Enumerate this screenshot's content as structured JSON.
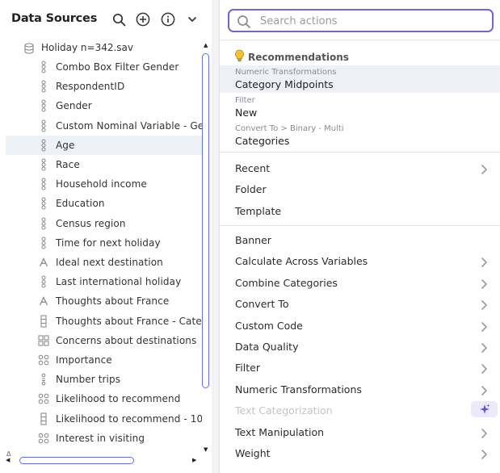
{
  "data_sources": {
    "title": "Data Sources",
    "file": {
      "label": "Holiday n=342.sav"
    },
    "variables": [
      {
        "label": "Combo Box Filter Gender",
        "icon": "numeric-var-icon"
      },
      {
        "label": "RespondentID",
        "icon": "numeric-var-icon"
      },
      {
        "label": "Gender",
        "icon": "numeric-var-icon"
      },
      {
        "label": "Custom Nominal Variable - Gen",
        "icon": "numeric-var-icon"
      },
      {
        "label": "Age",
        "icon": "numeric-var-icon",
        "selected": true
      },
      {
        "label": "Race",
        "icon": "numeric-var-icon"
      },
      {
        "label": "Household income",
        "icon": "numeric-var-icon"
      },
      {
        "label": "Education",
        "icon": "numeric-var-icon"
      },
      {
        "label": "Census region",
        "icon": "numeric-var-icon"
      },
      {
        "label": "Time for next holiday",
        "icon": "numeric-var-icon"
      },
      {
        "label": "Ideal next destination",
        "icon": "text-var-icon"
      },
      {
        "label": "Last international holiday",
        "icon": "numeric-var-icon"
      },
      {
        "label": "Thoughts about France",
        "icon": "text-var-icon"
      },
      {
        "label": "Thoughts about France - Categ",
        "icon": "categorical-var-icon"
      },
      {
        "label": "Concerns about destinations",
        "icon": "grid-var-icon"
      },
      {
        "label": "Importance",
        "icon": "multi-numeric-var-icon"
      },
      {
        "label": "Number trips",
        "icon": "numeric-count-var-icon"
      },
      {
        "label": "Likelihood to recommend",
        "icon": "multi-numeric-var-icon"
      },
      {
        "label": "Likelihood to recommend - 10",
        "icon": "categorical-var-icon"
      },
      {
        "label": "Interest in visiting",
        "icon": "multi-numeric-var-icon"
      }
    ]
  },
  "menu": {
    "search": {
      "placeholder": "Search actions",
      "value": ""
    },
    "recommendations": {
      "heading": "Recommendations",
      "items": [
        {
          "small": "Numeric Transformations",
          "main": "Category Midpoints",
          "highlighted": true
        },
        {
          "small": "Filter",
          "main": "New"
        },
        {
          "small": "Convert To > Binary - Multi",
          "main": "Categories"
        }
      ]
    },
    "group1": [
      {
        "label": "Recent",
        "submenu": true
      },
      {
        "label": "Folder",
        "submenu": false
      },
      {
        "label": "Template",
        "submenu": false
      }
    ],
    "group2": [
      {
        "label": "Banner",
        "submenu": false
      },
      {
        "label": "Calculate Across Variables",
        "submenu": true
      },
      {
        "label": "Combine Categories",
        "submenu": true
      },
      {
        "label": "Convert To",
        "submenu": true
      },
      {
        "label": "Custom Code",
        "submenu": true
      },
      {
        "label": "Data Quality",
        "submenu": true
      },
      {
        "label": "Filter",
        "submenu": true
      },
      {
        "label": "Numeric Transformations",
        "submenu": true
      },
      {
        "label": "Text Categorization",
        "submenu": false,
        "disabled": true,
        "ai": true
      },
      {
        "label": "Text Manipulation",
        "submenu": true
      },
      {
        "label": "Weight",
        "submenu": true
      }
    ]
  },
  "colors": {
    "accent": "#7b61d8",
    "scrollbar": "#6570d8",
    "selection": "#eef1f6",
    "bulb": "#f2c230"
  }
}
